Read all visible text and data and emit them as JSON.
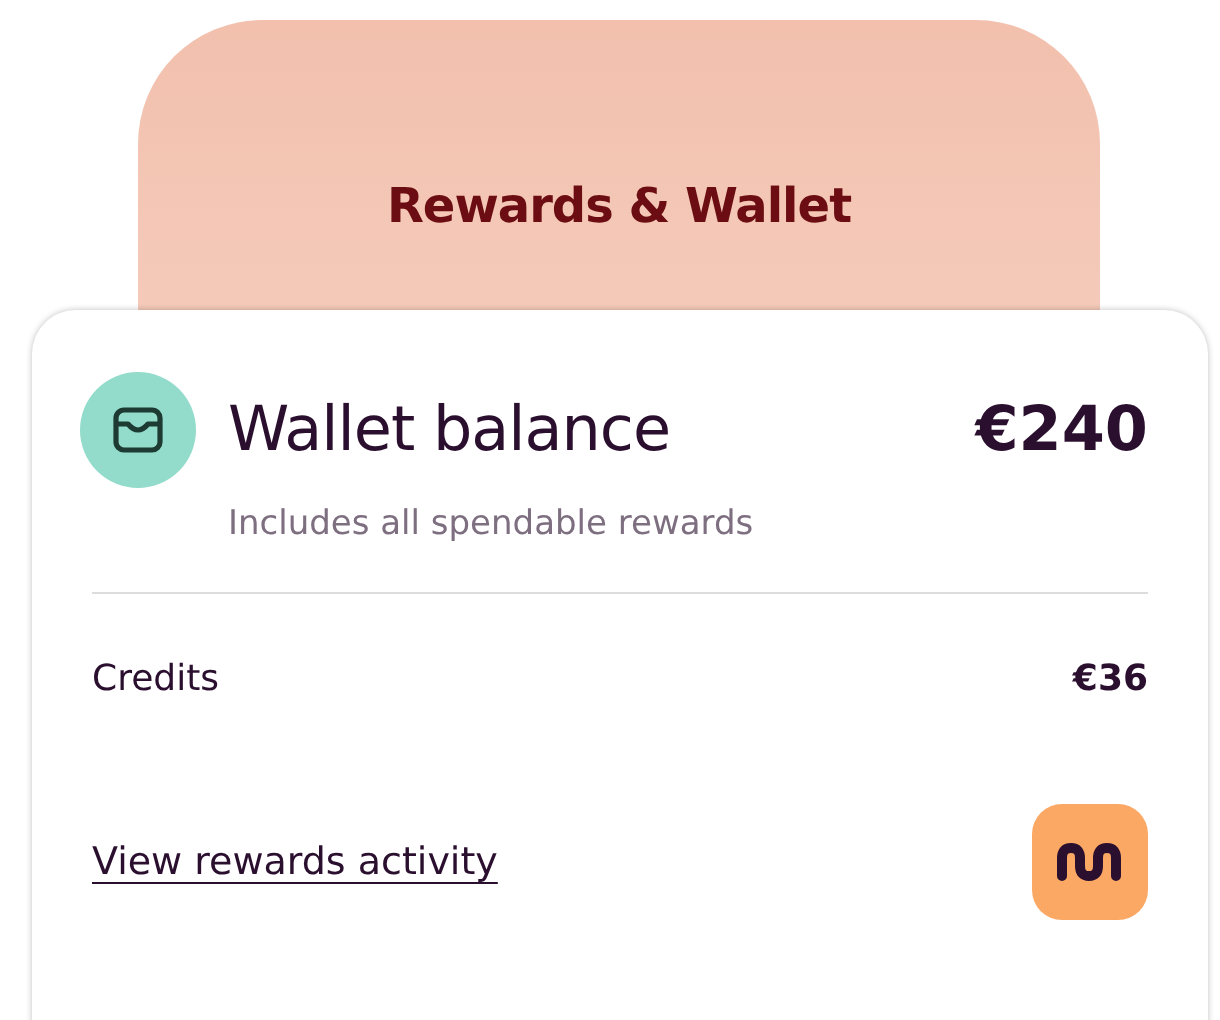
{
  "header": {
    "title": "Rewards & Wallet"
  },
  "wallet": {
    "title": "Wallet balance",
    "amount": "€240",
    "subtitle": "Includes all spendable rewards"
  },
  "rows": [
    {
      "label": "Credits",
      "value": "€36"
    }
  ],
  "link": {
    "label": "View rewards activity"
  }
}
